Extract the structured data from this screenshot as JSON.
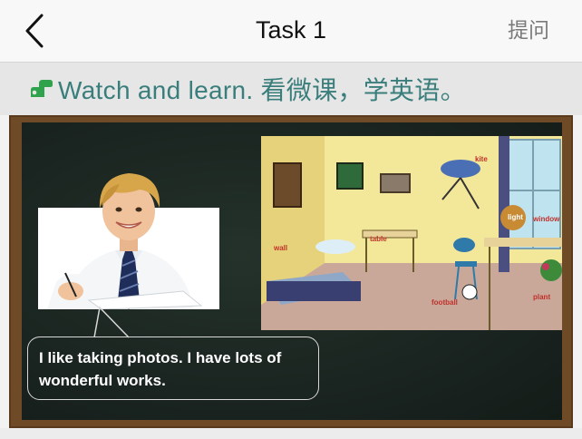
{
  "navbar": {
    "title": "Task 1",
    "action_label": "提问",
    "back_icon": "chevron-left-icon"
  },
  "subheader": {
    "icon": "whistle-icon",
    "text": "Watch and learn. 看微课，学英语。"
  },
  "video": {
    "caption": "I like taking photos. I have lots of wonderful works.",
    "room_labels": {
      "wall": "wall",
      "table": "table",
      "kite": "kite",
      "light": "light",
      "window": "window",
      "plant": "plant",
      "football": "football"
    }
  },
  "colors": {
    "accent": "#3a7e7c",
    "board": "#1c2622",
    "frame": "#6f4a26"
  }
}
